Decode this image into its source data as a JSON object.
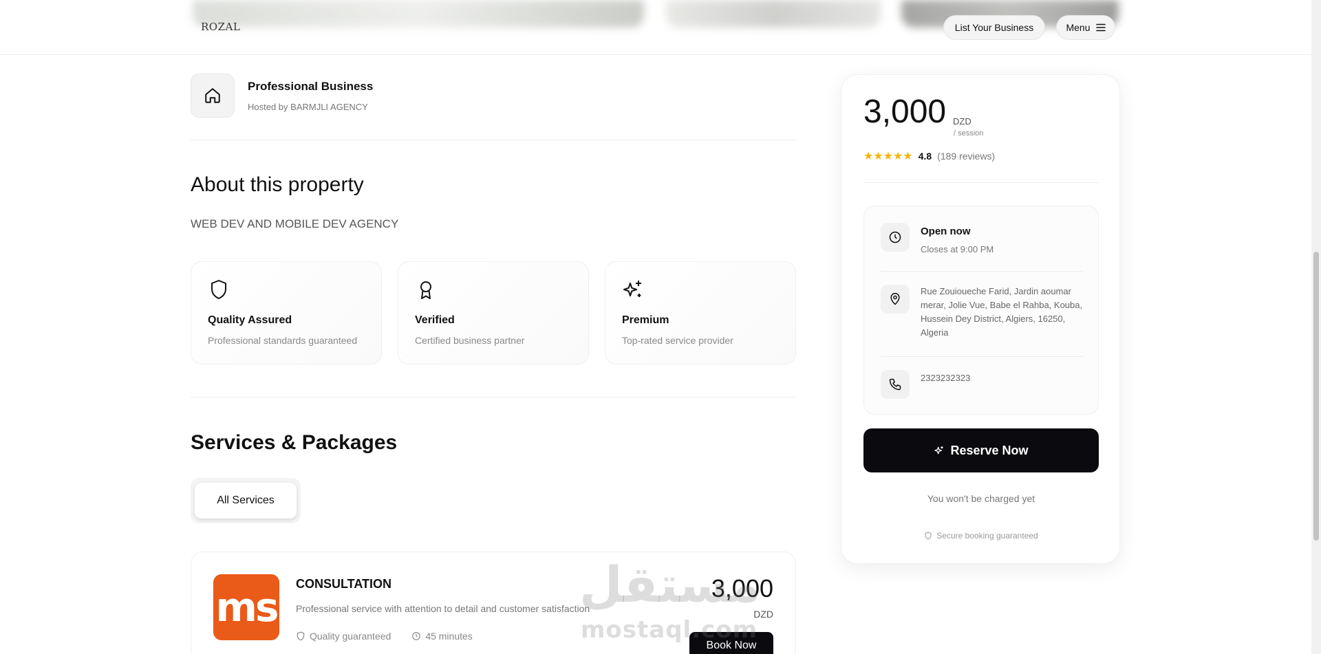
{
  "header": {
    "logo": "ROZAL",
    "list_business": "List Your Business",
    "menu": "Menu"
  },
  "host": {
    "title": "Professional Business",
    "hosted_by": "Hosted by BARMJLI AGENCY",
    "icon": "home-icon"
  },
  "about": {
    "heading": "About this property",
    "description": "WEB DEV AND MOBILE DEV AGENCY",
    "features": [
      {
        "title": "Quality Assured",
        "desc": "Professional standards guaranteed",
        "icon": "shield-icon"
      },
      {
        "title": "Verified",
        "desc": "Certified business partner",
        "icon": "award-icon"
      },
      {
        "title": "Premium",
        "desc": "Top-rated service provider",
        "icon": "sparkles-icon"
      }
    ]
  },
  "services": {
    "heading": "Services & Packages",
    "filter_all": "All Services",
    "items": [
      {
        "logo_text": "ms",
        "name": "CONSULTATION",
        "desc": "Professional service with attention to detail and customer satisfaction",
        "quality": "Quality guaranteed",
        "duration": "45 minutes",
        "price": "3,000",
        "currency": "DZD",
        "book": "Book Now"
      }
    ]
  },
  "booking": {
    "price": "3,000",
    "currency": "DZD",
    "unit": "/ session",
    "stars": "★★★★★",
    "rating": "4.8",
    "reviews": "(189 reviews)",
    "open_title": "Open now",
    "closes": "Closes at 9:00 PM",
    "address": "Rue Zouioueche Farid, Jardin aoumar merar, Jolie Vue, Babe el Rahba, Kouba, Hussein Dey District, Algiers, 16250, Algeria",
    "phone": "2323232323",
    "reserve": "Reserve Now",
    "not_charged": "You won't be charged yet",
    "secure": "Secure booking guaranteed"
  },
  "watermark": {
    "arabic": "مستقل",
    "latin": "mostaql.com"
  },
  "colors": {
    "accent_dark": "#0b0b0f",
    "star": "#f5b40a",
    "service_logo": "#ea5a18"
  }
}
